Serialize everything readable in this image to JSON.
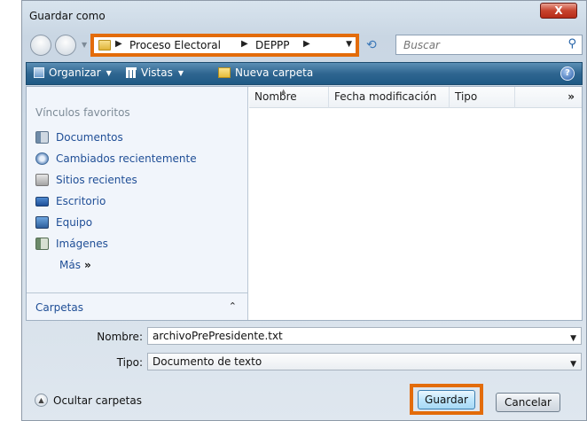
{
  "window": {
    "title": "Guardar como",
    "close_label": "X"
  },
  "address": {
    "segments": [
      "Proceso Electoral",
      "DEPPP"
    ],
    "search_placeholder": "Buscar"
  },
  "toolbar": {
    "organize_label": "Organizar",
    "views_label": "Vistas",
    "new_folder_label": "Nueva carpeta",
    "help_label": "?"
  },
  "sidebar": {
    "heading": "Vínculos favoritos",
    "items": [
      {
        "label": "Documentos",
        "icon": "documents-icon"
      },
      {
        "label": "Cambiados recientemente",
        "icon": "recently-changed-icon"
      },
      {
        "label": "Sitios recientes",
        "icon": "recent-sites-icon"
      },
      {
        "label": "Escritorio",
        "icon": "desktop-icon"
      },
      {
        "label": "Equipo",
        "icon": "computer-icon"
      },
      {
        "label": "Imágenes",
        "icon": "pictures-icon"
      }
    ],
    "more_label": "Más",
    "folders_label": "Carpetas"
  },
  "filelist": {
    "columns": [
      "Nombre",
      "Fecha modificación",
      "Tipo"
    ],
    "more_columns": "»"
  },
  "form": {
    "name_label": "Nombre:",
    "name_value": "archivoPrePresidente.txt",
    "type_label": "Tipo:",
    "type_value": "Documento de texto"
  },
  "footer": {
    "hide_folders_label": "Ocultar carpetas",
    "save_label": "Guardar",
    "cancel_label": "Cancelar"
  },
  "colors": {
    "highlight": "#e36c0a",
    "toolbar": "#2f6690",
    "link": "#1f4e96"
  }
}
